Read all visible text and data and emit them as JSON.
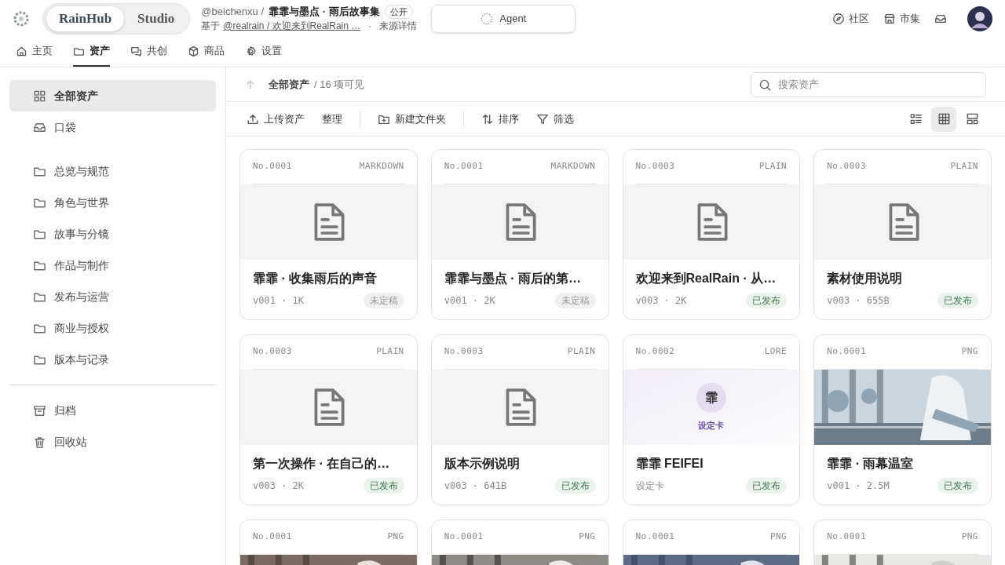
{
  "brand_switch": [
    {
      "label": "RainHub",
      "selected": true
    },
    {
      "label": "Studio",
      "selected": false
    }
  ],
  "project": {
    "owner": "@beichenxu /",
    "title": "霏霏与墨点 · 雨后故事集",
    "visibility": "公开",
    "based_on": "基于",
    "source_link": "@realrain / 欢迎来到RealRain …",
    "separator": "·",
    "source_details": "来源详情"
  },
  "agent_button": "Agent",
  "top_links": [
    {
      "kind": "compass",
      "label": "社区"
    },
    {
      "kind": "store",
      "label": "市集"
    },
    {
      "kind": "inbox"
    }
  ],
  "tabs": [
    {
      "kind": "home",
      "label": "主页",
      "selected": false
    },
    {
      "kind": "folder",
      "label": "资产",
      "selected": true
    },
    {
      "kind": "chat",
      "label": "共创",
      "selected": false
    },
    {
      "kind": "box",
      "label": "商品",
      "selected": false
    },
    {
      "kind": "gear",
      "label": "设置",
      "selected": false
    }
  ],
  "sidebar": {
    "sections": [
      {
        "items": [
          {
            "kind": "grid",
            "label": "全部资产",
            "selected": true
          },
          {
            "kind": "inbox",
            "label": "口袋",
            "selected": false
          }
        ]
      },
      {
        "items": [
          {
            "kind": "folder",
            "label": "总览与规范",
            "selected": false
          },
          {
            "kind": "folder",
            "label": "角色与世界",
            "selected": false
          },
          {
            "kind": "folder",
            "label": "故事与分镜",
            "selected": false
          },
          {
            "kind": "folder",
            "label": "作品与制作",
            "selected": false
          },
          {
            "kind": "folder",
            "label": "发布与运营",
            "selected": false
          },
          {
            "kind": "folder",
            "label": "商业与授权",
            "selected": false
          },
          {
            "kind": "folder",
            "label": "版本与记录",
            "selected": false
          }
        ]
      },
      {
        "items": [
          {
            "kind": "archive",
            "label": "归档",
            "selected": false
          },
          {
            "kind": "trash",
            "label": "回收站",
            "selected": false
          }
        ]
      }
    ]
  },
  "breadcrumb": {
    "current": "全部资产",
    "count": "/ 16 项可见"
  },
  "search": {
    "placeholder": "搜索资产"
  },
  "toolbar": [
    {
      "kind": "upload",
      "label": "上传资产"
    },
    {
      "kind": "text",
      "label": "整理"
    },
    {
      "kind": "divider"
    },
    {
      "kind": "new-folder",
      "label": "新建文件夹"
    },
    {
      "kind": "divider"
    },
    {
      "kind": "sort",
      "label": "排序"
    },
    {
      "kind": "filter",
      "label": "筛选"
    }
  ],
  "view_modes": [
    {
      "kind": "list",
      "selected": false
    },
    {
      "kind": "grid",
      "selected": true
    },
    {
      "kind": "gallery",
      "selected": false
    }
  ],
  "cards": [
    {
      "kind": "doc",
      "number": "No.0001",
      "type": "MARKDOWN",
      "title": "霏霏 · 收集雨后的声音",
      "meta": "v001 · 1K",
      "status": "未定稿",
      "published": false
    },
    {
      "kind": "doc",
      "number": "No.0001",
      "type": "MARKDOWN",
      "title": "霏霏与墨点 · 雨后的第…",
      "meta": "v001 · 2K",
      "status": "未定稿",
      "published": false
    },
    {
      "kind": "doc",
      "number": "No.0003",
      "type": "PLAIN",
      "title": "欢迎来到RealRain · 从…",
      "meta": "v003 · 2K",
      "status": "已发布",
      "published": true
    },
    {
      "kind": "doc",
      "number": "No.0003",
      "type": "PLAIN",
      "title": "素材使用说明",
      "meta": "v003 · 655B",
      "status": "已发布",
      "published": true
    },
    {
      "kind": "doc",
      "number": "No.0003",
      "type": "PLAIN",
      "title": "第一次操作 · 在自己的…",
      "meta": "v003 · 2K",
      "status": "已发布",
      "published": true
    },
    {
      "kind": "doc",
      "number": "No.0003",
      "type": "PLAIN",
      "title": "版本示例说明",
      "meta": "v003 · 641B",
      "status": "已发布",
      "published": true
    },
    {
      "kind": "lore",
      "number": "No.0002",
      "type": "LORE",
      "avatar_char": "霏",
      "lore_label": "设定卡",
      "title": "霏霏 FEIFEI",
      "meta": "设定卡",
      "status": "已发布",
      "published": true
    },
    {
      "number": "No.0001",
      "type": "PNG",
      "title": "霏霏 · 雨幕温室",
      "meta": "v001 · 2.5M",
      "status": "已发布",
      "published": true
    },
    {
      "number": "No.0001",
      "type": "PNG"
    },
    {
      "number": "No.0001",
      "type": "PNG"
    },
    {
      "number": "No.0001",
      "type": "PNG"
    },
    {
      "number": "No.0001",
      "type": "PNG"
    }
  ]
}
